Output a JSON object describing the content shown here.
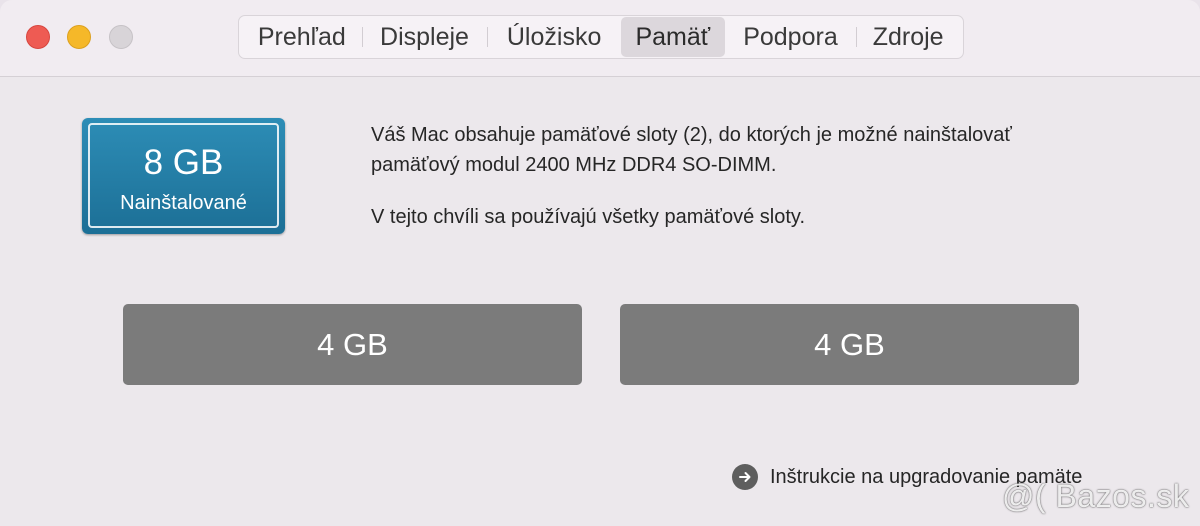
{
  "tabs": [
    {
      "label": "Prehľad"
    },
    {
      "label": "Displeje"
    },
    {
      "label": "Úložisko"
    },
    {
      "label": "Pamäť"
    },
    {
      "label": "Podpora"
    },
    {
      "label": "Zdroje"
    }
  ],
  "active_tab": "Pamäť",
  "installed": {
    "size": "8 GB",
    "label": "Nainštalované"
  },
  "description": {
    "line1": "Váš Mac obsahuje pamäťové sloty (2), do ktorých je možné nainštalovať pamäťový modul 2400 MHz DDR4 SO-DIMM.",
    "line2": "V tejto chvíli sa používajú všetky pamäťové sloty."
  },
  "slots": [
    {
      "size": "4 GB"
    },
    {
      "size": "4 GB"
    }
  ],
  "upgrade_link": "Inštrukcie na upgradovanie pamäte",
  "watermark": "@( Bazos.sk",
  "colors": {
    "installed_badge": "#2483ad",
    "slot_fill": "#7b7b7b",
    "close": "#ee5b53",
    "minimize": "#f5b829",
    "zoom_inactive": "#d8d4d8"
  }
}
